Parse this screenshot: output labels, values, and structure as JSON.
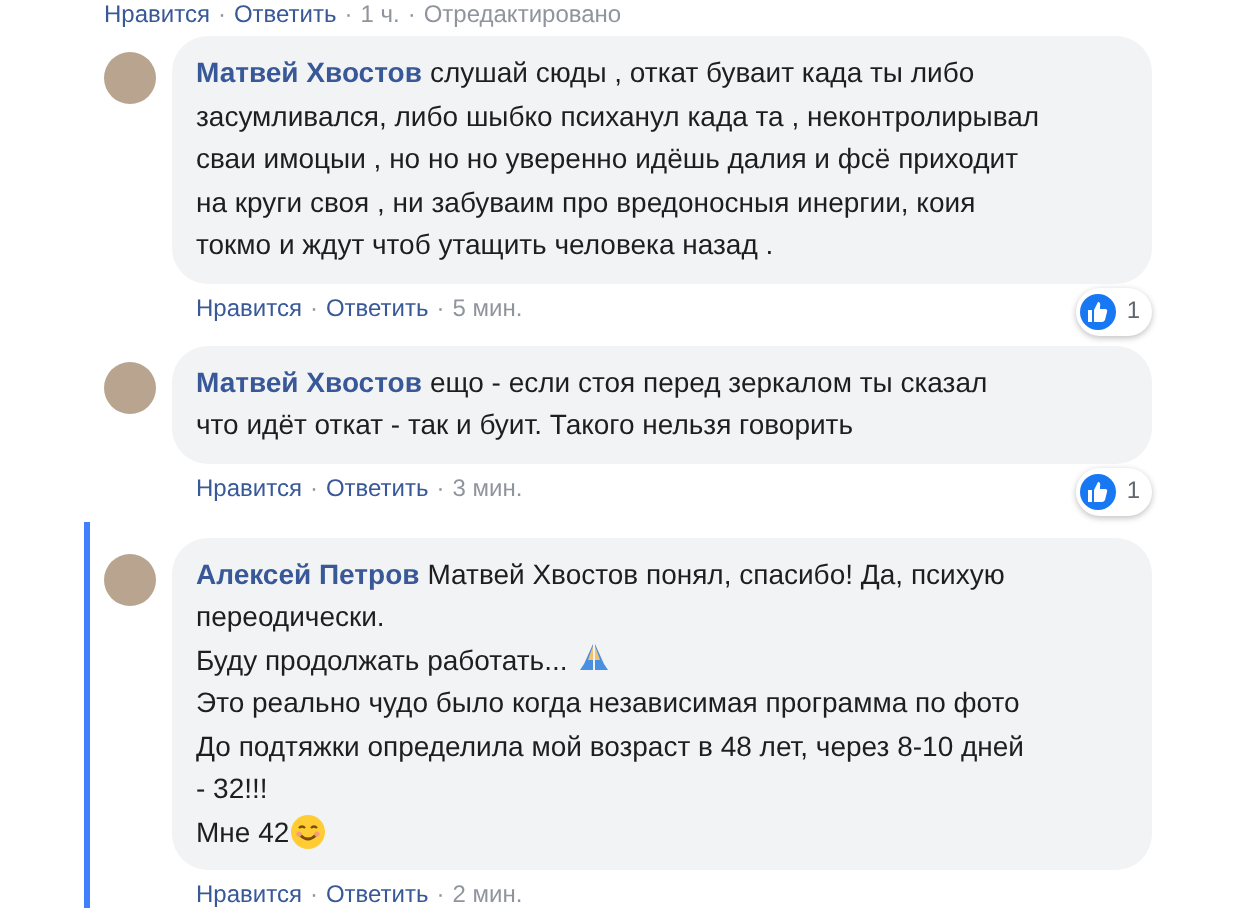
{
  "separator": "·",
  "previous_actions": {
    "like": "Нравится",
    "reply": "Ответить",
    "time": "1 ч.",
    "edited": "Отредактировано"
  },
  "comments": [
    {
      "author": "Матвей Хвостов",
      "reply_thread": false,
      "paragraphs": [
        "слушай сюды , откат буваит када ты либо\nзасумливался, либо шыбко психанул када та , неконтролирывал\nсваи имоцыи , но но но уверенно идёшь далия и фсё приходит\nна круги своя , ни забуваим про вредоносныя инергии, коия\nтокмо и ждут чтоб утащить человека назад ."
      ],
      "like": "Нравится",
      "reply": "Ответить",
      "time": "5 мин.",
      "reactions": "1"
    },
    {
      "author": "Матвей Хвостов",
      "reply_thread": false,
      "paragraphs": [
        "ещо - если стоя перед зеркалом ты сказал\nчто идёт откат - так и буит. Такого нельзя говорить"
      ],
      "like": "Нравится",
      "reply": "Ответить",
      "time": "3 мин.",
      "reactions": "1"
    },
    {
      "author": "Алексей Петров",
      "reply_thread": true,
      "paragraphs": [
        "Матвей Хвостов понял, спасибо! Да, психую\nпереодически.",
        "Буду продолжать работать...",
        "Это реально чудо было когда независимая программа по фото\nДо подтяжки определила мой возраст в 48 лет, через 8-10 дней\n- 32!!!",
        "Мне 42"
      ],
      "like": "Нравится",
      "reply": "Ответить",
      "time": "2 мин."
    }
  ]
}
